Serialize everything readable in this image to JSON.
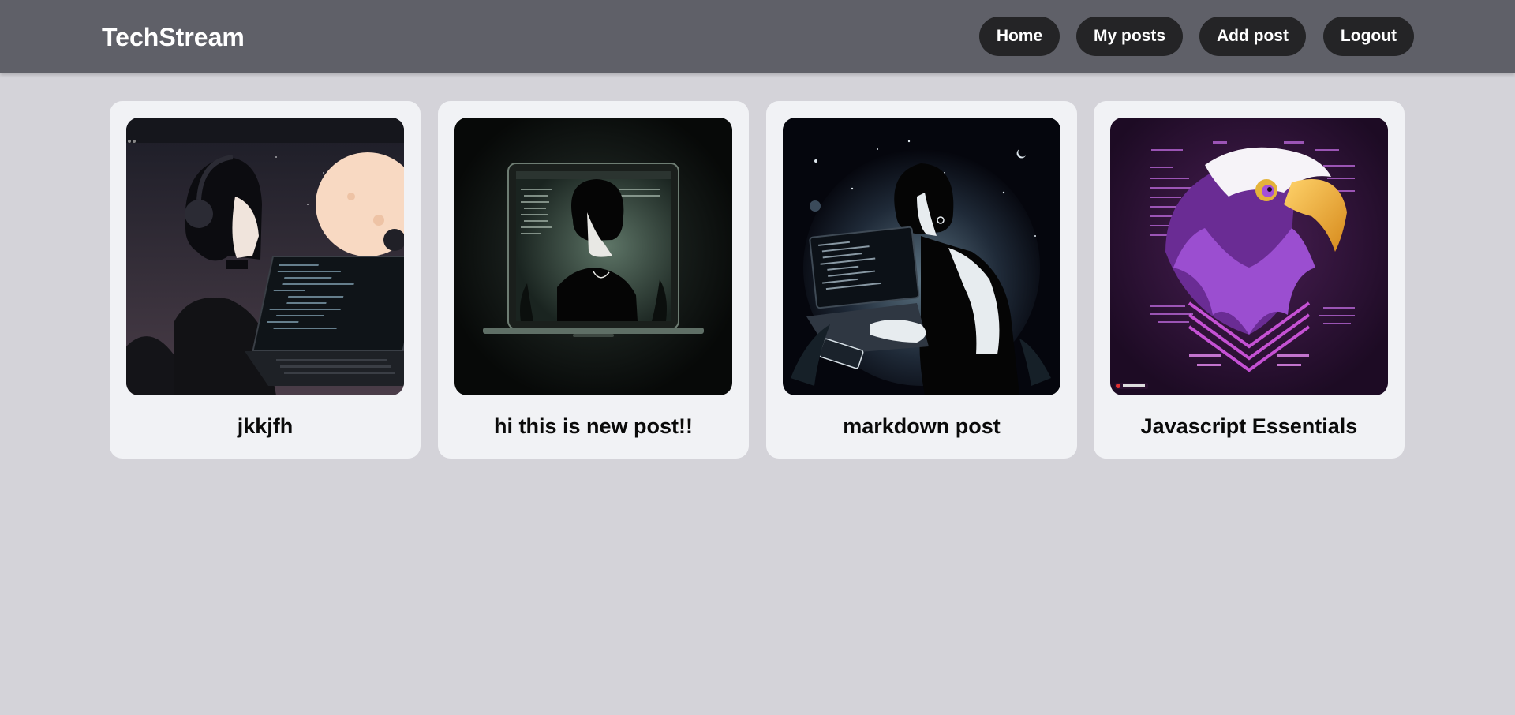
{
  "navbar": {
    "brand": "TechStream",
    "links": {
      "home": "Home",
      "my_posts": "My posts",
      "add_post": "Add post",
      "logout": "Logout"
    }
  },
  "posts": [
    {
      "title": "jkkjfh",
      "image": "girl-with-headphones-laptop-moon"
    },
    {
      "title": "hi this is new post!!",
      "image": "laptop-girl-silhouette"
    },
    {
      "title": "markdown post",
      "image": "girl-typing-laptop-night"
    },
    {
      "title": "Javascript Essentials",
      "image": "purple-eagle-code"
    }
  ],
  "colors": {
    "navbar_bg": "#5f6068",
    "page_bg": "#d4d3d9",
    "button_bg": "#242426",
    "card_bg": "#f1f2f5"
  }
}
